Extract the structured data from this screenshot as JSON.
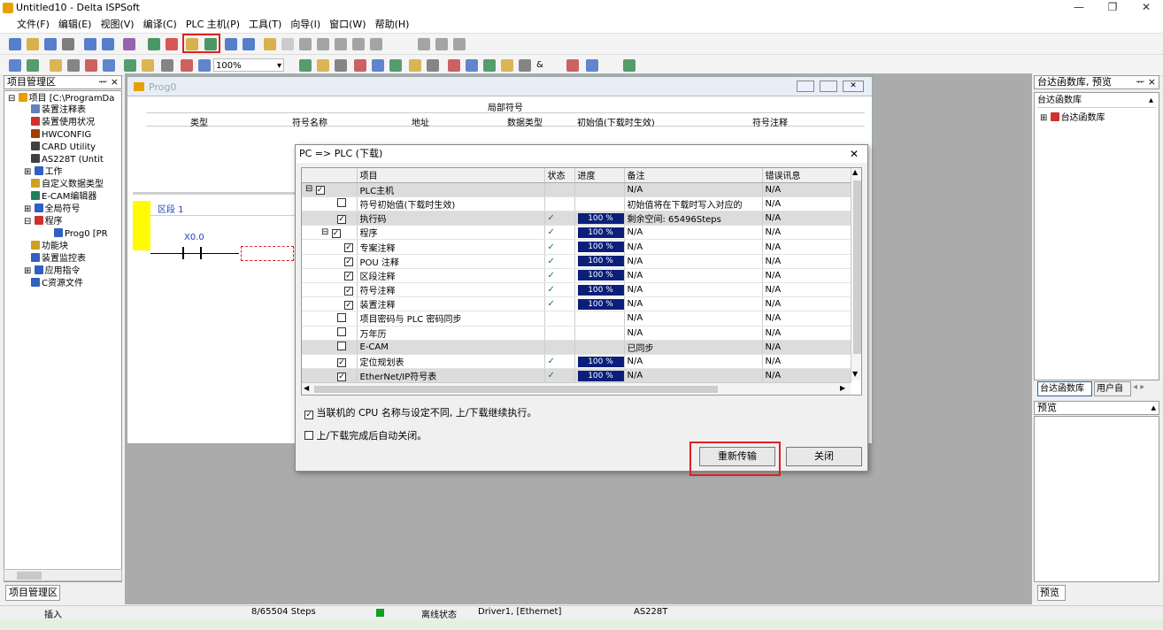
{
  "window": {
    "title": "Untitled10 - Delta ISPSoft",
    "min": "—",
    "max": "❐",
    "close": "✕"
  },
  "menu": [
    "文件(F)",
    "编辑(E)",
    "视图(V)",
    "编译(C)",
    "PLC 主机(P)",
    "工具(T)",
    "向导(I)",
    "窗口(W)",
    "帮助(H)"
  ],
  "toolbar": {
    "zoom": "100%",
    "amp": "&"
  },
  "left": {
    "title": "项目管理区",
    "pin": "ᅲ ×",
    "tab": "项目管理区",
    "tree": [
      "项目 [C:\\ProgramDa",
      "装置注释表",
      "装置使用状况",
      "HWCONFIG",
      "CARD Utility",
      "AS228T (Untit",
      "工作",
      "自定义数据类型",
      "E-CAM编辑器",
      "全局符号",
      "程序",
      "Prog0 [PR",
      "功能块",
      "装置监控表",
      "应用指令",
      "C资源文件"
    ]
  },
  "right": {
    "title": "台达函数库, 预览",
    "pin": "ᅲ ×",
    "lib_header": "台达函数库",
    "lib_node": "台达函数库",
    "tab1": "台达函数库",
    "tab2": "用户自",
    "preview": "预览",
    "tab3": "预览"
  },
  "prog": {
    "title": "Prog0",
    "local_symbols": "局部符号",
    "cols": [
      "类型",
      "符号名称",
      "地址",
      "数据类型",
      "初始值(下载时生效)",
      "符号注释"
    ],
    "section": "区段 1",
    "contact": "X0.0"
  },
  "dialog": {
    "title": "PC => PLC (下载)",
    "close": "✕",
    "headers": [
      "项目",
      "状态",
      "进度",
      "备注",
      "错误讯息"
    ],
    "rows": [
      {
        "item": "PLC主机",
        "checked": true,
        "note": "N/A",
        "err": "N/A",
        "shade": true,
        "exp": "⊟",
        "lvl": 0
      },
      {
        "item": "符号初始值(下载时生效)",
        "checked": false,
        "note": "初始值将在下载时写入对应的",
        "err": "N/A",
        "lvl": 1
      },
      {
        "item": "执行码",
        "checked": true,
        "status": "✓",
        "progress": "100 %",
        "note": "剩余空间: 65496Steps",
        "err": "N/A",
        "shade": true,
        "lvl": 1
      },
      {
        "item": "程序",
        "checked": true,
        "status": "✓",
        "progress": "100 %",
        "note": "N/A",
        "err": "N/A",
        "exp": "⊟",
        "lvl": 1
      },
      {
        "item": "专案注释",
        "checked": true,
        "status": "✓",
        "progress": "100 %",
        "note": "N/A",
        "err": "N/A",
        "lvl": 2
      },
      {
        "item": "POU 注释",
        "checked": true,
        "status": "✓",
        "progress": "100 %",
        "note": "N/A",
        "err": "N/A",
        "lvl": 2
      },
      {
        "item": "区段注释",
        "checked": true,
        "status": "✓",
        "progress": "100 %",
        "note": "N/A",
        "err": "N/A",
        "lvl": 2
      },
      {
        "item": "符号注释",
        "checked": true,
        "status": "✓",
        "progress": "100 %",
        "note": "N/A",
        "err": "N/A",
        "lvl": 2
      },
      {
        "item": "装置注释",
        "checked": true,
        "status": "✓",
        "progress": "100 %",
        "note": "N/A",
        "err": "N/A",
        "lvl": 2
      },
      {
        "item": "项目密码与 PLC 密码同步",
        "checked": false,
        "note": "N/A",
        "err": "N/A",
        "lvl": 1
      },
      {
        "item": "万年历",
        "checked": false,
        "note": "N/A",
        "err": "N/A",
        "lvl": 1
      },
      {
        "item": "E-CAM",
        "checked": false,
        "note": "已同步",
        "err": "N/A",
        "shade": true,
        "lvl": 1
      },
      {
        "item": "定位规划表",
        "checked": true,
        "status": "✓",
        "progress": "100 %",
        "note": "N/A",
        "err": "N/A",
        "lvl": 1
      },
      {
        "item": "EtherNet/IP符号表",
        "checked": true,
        "status": "✓",
        "progress": "100 %",
        "note": "N/A",
        "err": "N/A",
        "shade": true,
        "lvl": 1
      }
    ],
    "opt1": "当联机的 CPU 名称与设定不同, 上/下载继续执行。",
    "opt2": "上/下载完成后自动关闭。",
    "btn_retry": "重新传输",
    "btn_close": "关闭"
  },
  "status": {
    "mode": "插入",
    "steps": "8/65504 Steps",
    "conn": "离线状态",
    "driver": "Driver1, [Ethernet]",
    "model": "AS228T"
  },
  "colors": {
    "progress": "#0b1f7a",
    "highlight": "#e02020"
  }
}
